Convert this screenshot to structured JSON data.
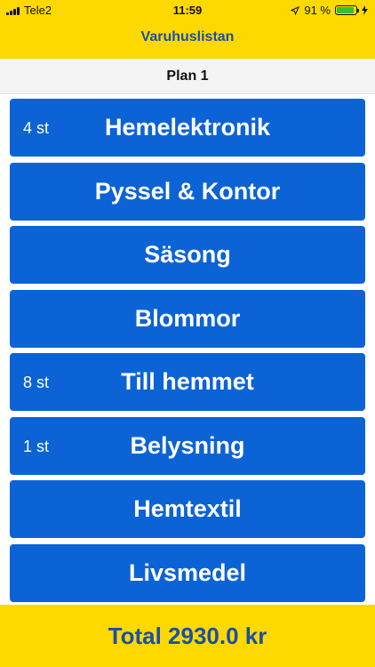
{
  "status_bar": {
    "carrier": "Tele2",
    "time": "11:59",
    "battery_percent": "91 %",
    "battery_level": 0.91,
    "icons": [
      "signal-icon",
      "location-arrow-icon",
      "battery-icon",
      "charging-bolt-icon"
    ]
  },
  "nav": {
    "title": "Varuhuslistan"
  },
  "section": {
    "title": "Plan 1"
  },
  "categories": [
    {
      "count": "4 st",
      "name": "Hemelektronik"
    },
    {
      "count": "",
      "name": "Pyssel & Kontor"
    },
    {
      "count": "",
      "name": "Säsong"
    },
    {
      "count": "",
      "name": "Blommor"
    },
    {
      "count": "8 st",
      "name": "Till hemmet"
    },
    {
      "count": "1 st",
      "name": "Belysning"
    },
    {
      "count": "",
      "name": "Hemtextil"
    },
    {
      "count": "",
      "name": "Livsmedel"
    }
  ],
  "footer": {
    "total": "Total 2930.0 kr"
  },
  "colors": {
    "header_yellow": "#fed900",
    "button_blue": "#0c63d6",
    "title_blue": "#1b4fa8",
    "battery_green": "#2ec52e"
  }
}
